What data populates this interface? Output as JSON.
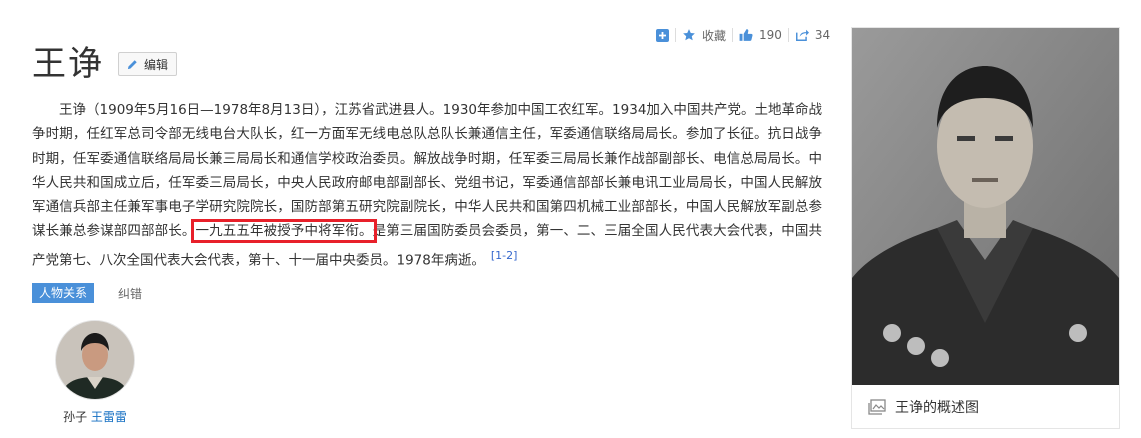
{
  "toolbar": {
    "collect_label": "收藏",
    "like_count": "190",
    "share_count": "34"
  },
  "header": {
    "title": "王诤",
    "edit_label": "编辑"
  },
  "summary": {
    "part1": "王诤（1909年5月16日—1978年8月13日），江苏省武进县人。1930年参加中国工农红军。1934加入中国共产党。土地革命战争时期，任红军总司令部无线电台大队长，红一方面军无线电总队总队长兼通信主任，军委通信联络局局长。参加了长征。抗日战争时期，任军委通信联络局局长兼三局局长和通信学校政治委员。解放战争时期，任军委三局局长兼作战部副部长、电信总局局长。中华人民共和国成立后，任军委三局局长，中央人民政府邮电部副部长、党组书记，军委通信部部长兼电讯工业局局长，中国人民解放军通信兵部主任兼军事电子学研究院院长，国防部第五研究院副院长，中华人民共和国第四机械工业部部长，中国人民解放军副总参谋长兼总参谋部四部部长。",
    "highlight": "一九五五年被授予中将军衔。",
    "part2": "是第三届国防委员会委员，第一、二、三届全国人民代表大会代表，中国共产党第七、八次全国代表大会代表，第十、十一届中央委员。1978年病逝。",
    "ref": "[1-2]"
  },
  "relations": {
    "tab_label": "人物关系",
    "correct_label": "纠错",
    "person": {
      "relation": "孙子",
      "name": "王雷雷"
    }
  },
  "album": {
    "caption": "王诤的概述图"
  },
  "colors": {
    "accent_blue": "#4a90d9",
    "link_blue": "#136ec2",
    "highlight_red": "#e8202a"
  }
}
